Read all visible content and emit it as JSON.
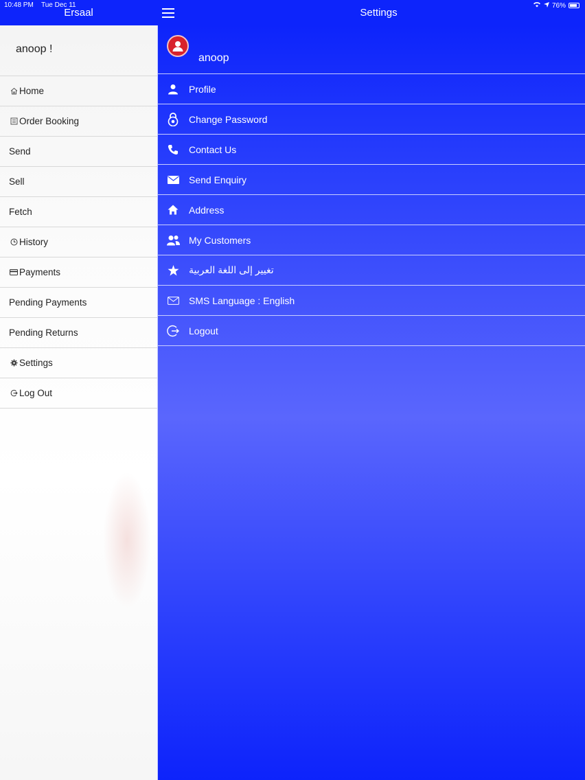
{
  "status_bar": {
    "time": "10:48 PM",
    "date": "Tue Dec 11",
    "battery": "76%"
  },
  "app_title": "Ersaal",
  "page_title": "Settings",
  "drawer": {
    "greeting": "anoop !",
    "items": [
      {
        "label": "Home",
        "icon": "home-outline-icon"
      },
      {
        "label": "Order Booking",
        "icon": "list-icon"
      },
      {
        "label": "Send",
        "icon": ""
      },
      {
        "label": "Sell",
        "icon": ""
      },
      {
        "label": "Fetch",
        "icon": ""
      },
      {
        "label": "History",
        "icon": "clock-icon"
      },
      {
        "label": "Payments",
        "icon": "card-icon"
      },
      {
        "label": "Pending Payments",
        "icon": ""
      },
      {
        "label": "Pending Returns",
        "icon": ""
      },
      {
        "label": "Settings",
        "icon": "gear-icon"
      },
      {
        "label": "Log Out",
        "icon": "logout-icon"
      }
    ]
  },
  "settings": {
    "username": "anoop",
    "items": [
      {
        "label": "Profile",
        "icon": "person-icon"
      },
      {
        "label": "Change Password",
        "icon": "lock-icon"
      },
      {
        "label": "Contact Us",
        "icon": "phone-icon"
      },
      {
        "label": "Send Enquiry",
        "icon": "envelope-icon"
      },
      {
        "label": "Address",
        "icon": "home-icon"
      },
      {
        "label": "My Customers",
        "icon": "people-icon"
      },
      {
        "label": "تغيير إلى اللغة العربية",
        "icon": "star-icon"
      },
      {
        "label": "SMS Language : English",
        "icon": "mail-outline-icon"
      },
      {
        "label": "Logout",
        "icon": "logout-icon"
      }
    ]
  },
  "colors": {
    "primary_blue": "#0d24fb",
    "avatar_red": "#d8222c"
  }
}
